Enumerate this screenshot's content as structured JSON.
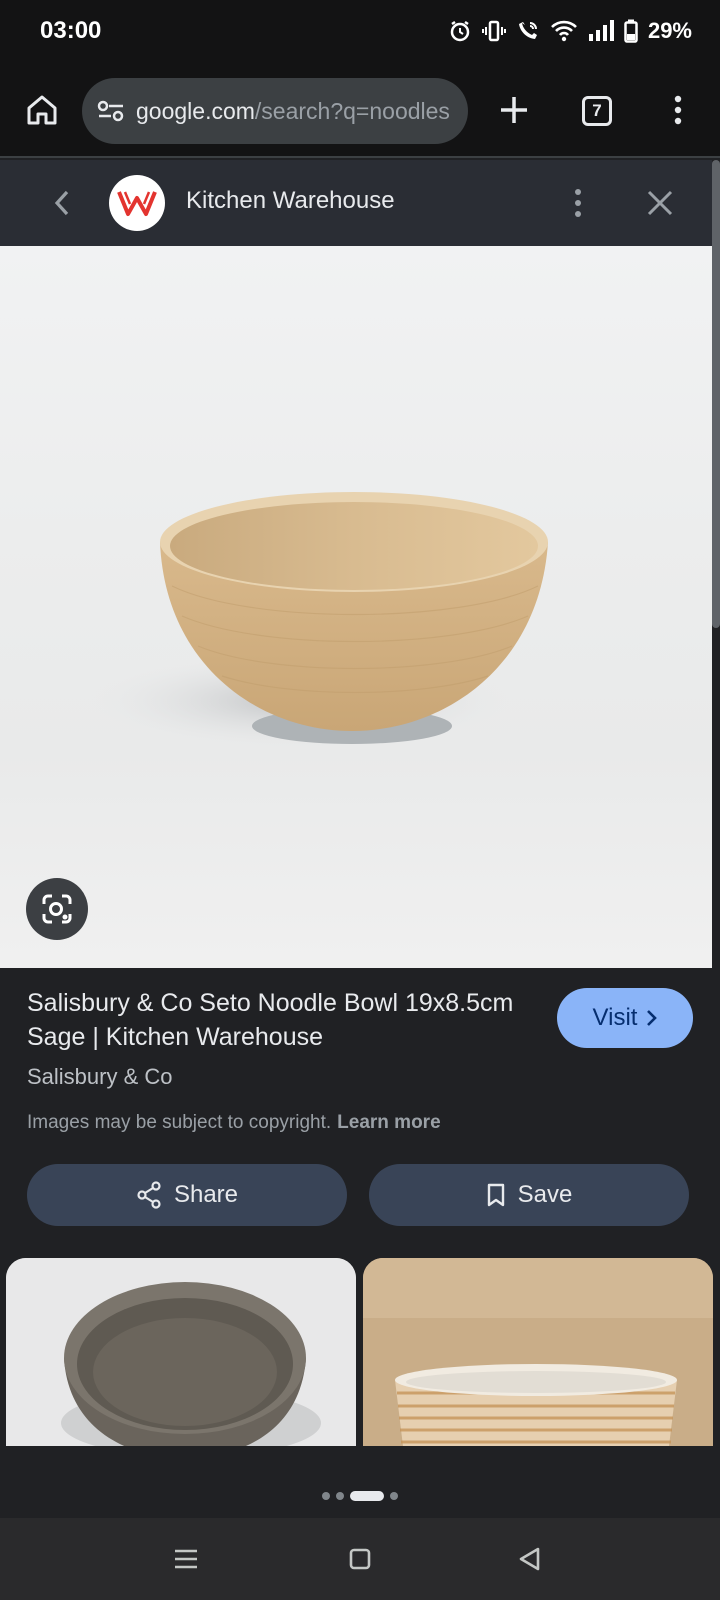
{
  "status_bar": {
    "time": "03:00",
    "battery": "29%",
    "icons": [
      "alarm-icon",
      "vibrate-icon",
      "wifi-call-icon",
      "wifi-icon",
      "signal-icon",
      "battery-icon"
    ]
  },
  "browser": {
    "url_host": "google.com",
    "url_path": "/search?q=noodles",
    "tab_count": "7"
  },
  "site": {
    "name": "Kitchen Warehouse",
    "logo_color": "#e3342f"
  },
  "result": {
    "title": "Salisbury & Co Seto Noodle Bowl 19x8.5cm Sage | Kitchen Warehouse",
    "source": "Salisbury & Co",
    "visit_label": "Visit",
    "copyright_text": "Images may be subject to copyright.",
    "learn_more": "Learn more",
    "share_label": "Share",
    "save_label": "Save"
  },
  "pager": {
    "page_count": 4,
    "active_index": 2
  },
  "colors": {
    "visit_button": "#8ab4f8",
    "action_button": "#394457",
    "background": "#202124"
  }
}
